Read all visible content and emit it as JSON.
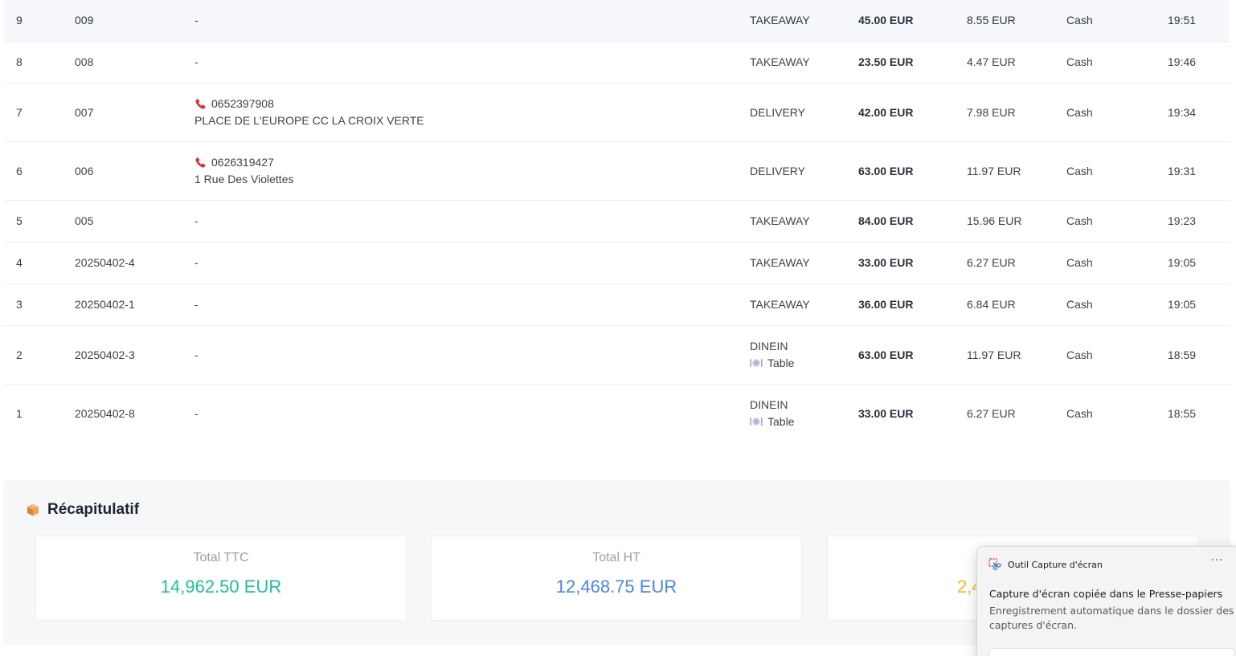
{
  "orders": [
    {
      "num": "9",
      "id": "009",
      "client_phone": "",
      "client_address": "",
      "client_placeholder": "-",
      "type": "TAKEAWAY",
      "table_label": "",
      "total_ttc": "45.00 EUR",
      "tva": "8.55 EUR",
      "payment": "Cash",
      "time": "19:51"
    },
    {
      "num": "8",
      "id": "008",
      "client_phone": "",
      "client_address": "",
      "client_placeholder": "-",
      "type": "TAKEAWAY",
      "table_label": "",
      "total_ttc": "23.50 EUR",
      "tva": "4.47 EUR",
      "payment": "Cash",
      "time": "19:46"
    },
    {
      "num": "7",
      "id": "007",
      "client_phone": "0652397908",
      "client_address": "PLACE DE L'EUROPE CC LA CROIX VERTE",
      "client_placeholder": "",
      "type": "DELIVERY",
      "table_label": "",
      "total_ttc": "42.00 EUR",
      "tva": "7.98 EUR",
      "payment": "Cash",
      "time": "19:34"
    },
    {
      "num": "6",
      "id": "006",
      "client_phone": "0626319427",
      "client_address": "1 Rue Des Violettes",
      "client_placeholder": "",
      "type": "DELIVERY",
      "table_label": "",
      "total_ttc": "63.00 EUR",
      "tva": "11.97 EUR",
      "payment": "Cash",
      "time": "19:31"
    },
    {
      "num": "5",
      "id": "005",
      "client_phone": "",
      "client_address": "",
      "client_placeholder": "-",
      "type": "TAKEAWAY",
      "table_label": "",
      "total_ttc": "84.00 EUR",
      "tva": "15.96 EUR",
      "payment": "Cash",
      "time": "19:23"
    },
    {
      "num": "4",
      "id": "20250402-4",
      "client_phone": "",
      "client_address": "",
      "client_placeholder": "-",
      "type": "TAKEAWAY",
      "table_label": "",
      "total_ttc": "33.00 EUR",
      "tva": "6.27 EUR",
      "payment": "Cash",
      "time": "19:05"
    },
    {
      "num": "3",
      "id": "20250402-1",
      "client_phone": "",
      "client_address": "",
      "client_placeholder": "-",
      "type": "TAKEAWAY",
      "table_label": "",
      "total_ttc": "36.00 EUR",
      "tva": "6.84 EUR",
      "payment": "Cash",
      "time": "19:05"
    },
    {
      "num": "2",
      "id": "20250402-3",
      "client_phone": "",
      "client_address": "",
      "client_placeholder": "-",
      "type": "DINEIN",
      "table_label": "Table",
      "total_ttc": "63.00 EUR",
      "tva": "11.97 EUR",
      "payment": "Cash",
      "time": "18:59"
    },
    {
      "num": "1",
      "id": "20250402-8",
      "client_phone": "",
      "client_address": "",
      "client_placeholder": "-",
      "type": "DINEIN",
      "table_label": "Table",
      "total_ttc": "33.00 EUR",
      "tva": "6.27 EUR",
      "payment": "Cash",
      "time": "18:55"
    }
  ],
  "summary": {
    "icon": "package-icon",
    "title": "Récapitulatif",
    "cards": [
      {
        "label": "Total TTC",
        "value": "14,962.50 EUR",
        "color": "#1fbf9a"
      },
      {
        "label": "Total HT",
        "value": "12,468.75 EUR",
        "color": "#4a86e0"
      },
      {
        "label": "",
        "value": "2,4",
        "color": "#f5b81c"
      }
    ]
  },
  "toast": {
    "app_name": "Outil Capture d'écran",
    "more_label": "···",
    "title": "Capture d'écran copiée dans le Presse-papiers",
    "body": "Enregistrement automatique dans le dossier des captures d'écran."
  }
}
